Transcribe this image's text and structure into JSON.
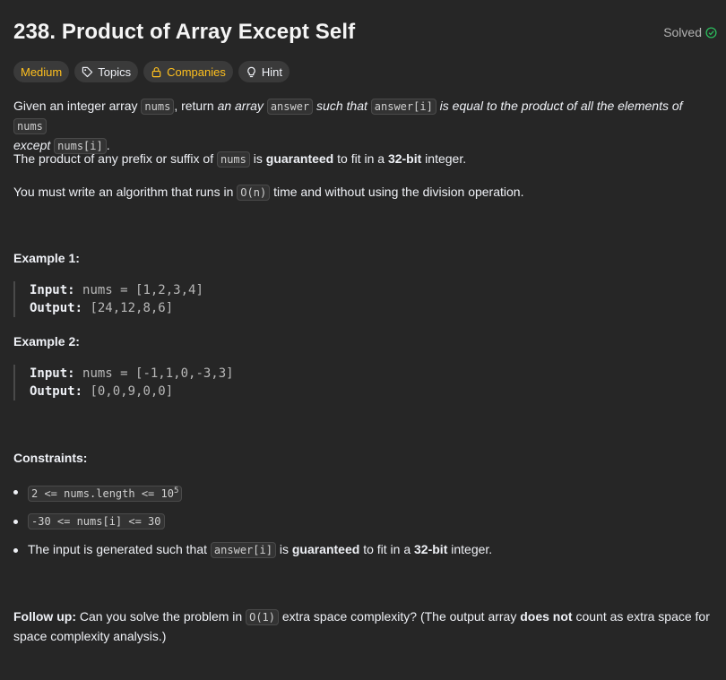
{
  "title": "238. Product of Array Except Self",
  "status": "Solved",
  "tags": {
    "difficulty": "Medium",
    "topics": "Topics",
    "companies": "Companies",
    "hint": "Hint"
  },
  "p1": {
    "a": "Given an integer array ",
    "c1": "nums",
    "b": ", return ",
    "e1": "an array",
    "c2": "answer",
    "e2": " such that ",
    "c3": "answer[i]",
    "e3": " is equal to the product of all the elements of ",
    "c4": "nums",
    "e4": "except",
    "c5": "nums[i]",
    "end": "."
  },
  "p2": {
    "a": "The product of any prefix or suffix of ",
    "c1": "nums",
    "b": " is ",
    "b1": "guaranteed",
    "c": " to fit in a ",
    "b2": "32-bit",
    "d": " integer."
  },
  "p3": {
    "a": "You must write an algorithm that runs in ",
    "c1": "O(n)",
    "b": " time and without using the division operation."
  },
  "examples": [
    {
      "title": "Example 1:",
      "input_label": "Input:",
      "input": "nums = [1,2,3,4]",
      "output_label": "Output:",
      "output": "[24,12,8,6]"
    },
    {
      "title": "Example 2:",
      "input_label": "Input:",
      "input": "nums = [-1,1,0,-3,3]",
      "output_label": "Output:",
      "output": "[0,0,9,0,0]"
    }
  ],
  "constraints": {
    "title": "Constraints:",
    "c1_code": "2 <= nums.length <= 10",
    "c1_sup": "5",
    "c2_code": "-30 <= nums[i] <= 30",
    "c3_a": "The input is generated such that ",
    "c3_code": "answer[i]",
    "c3_b": " is ",
    "c3_bold1": "guaranteed",
    "c3_c": " to fit in a ",
    "c3_bold2": "32-bit",
    "c3_d": " integer."
  },
  "followup": {
    "label": "Follow up:",
    "a": " Can you solve the problem in ",
    "code": "O(1)",
    "b": " extra space complexity? (The output array ",
    "bold": "does not",
    "c": " count as extra space for space complexity analysis.)"
  },
  "colors": {
    "background": "#262626",
    "accent": "#ffc01e",
    "solved": "#2cbb5d"
  }
}
